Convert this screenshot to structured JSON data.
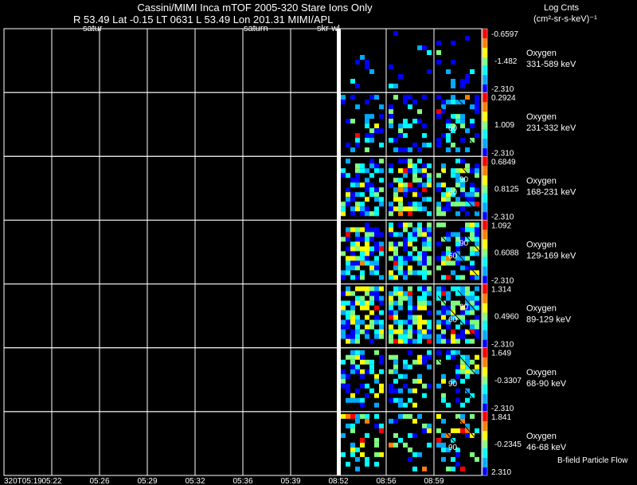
{
  "header": {
    "title": "Cassini/MIMI Inca mTOF  2005-320   Stare    Ions Only",
    "ephemeris": "R         53.49 Lat -0.15 LT 0631 L          53.49 Lon       201.31   MIMI/APL",
    "units_line1": "Log Cnts",
    "units_line2": "(cm²-sr-s-keV)⁻¹"
  },
  "annotations": [
    "satur",
    "saturn",
    "skr-wl"
  ],
  "footer": {
    "text": "B-field Particle Flow"
  },
  "chart_data": {
    "type": "heatmap",
    "time_labels": [
      "320T05:19",
      "05:22",
      "05:26",
      "05:29",
      "05:32",
      "05:36",
      "05:39",
      "08:52",
      "08:56",
      "08:59"
    ],
    "colorscale": [
      "#0000ff",
      "#00aaff",
      "#00ffff",
      "#80ff80",
      "#ffff00",
      "#ff8000",
      "#ff0000"
    ],
    "panels": [
      {
        "species": "Oxygen",
        "energy": "331-589 keV",
        "cmax": "-0.6597",
        "cmid": "-1.482",
        "cmin": "-2.310",
        "density": 0.1,
        "bias": 0.1,
        "contours": []
      },
      {
        "species": "Oxygen",
        "energy": "231-332 keV",
        "cmax": "0.2924",
        "cmid": "1.009",
        "cmin": "-2.310",
        "density": 0.35,
        "bias": 0.2,
        "contours": [
          "60"
        ]
      },
      {
        "species": "Oxygen",
        "energy": "168-231 keV",
        "cmax": "0.6849",
        "cmid": "0.8125",
        "cmin": "-2.310",
        "density": 0.55,
        "bias": 0.3,
        "contours": [
          "60",
          "90"
        ]
      },
      {
        "species": "Oxygen",
        "energy": "129-169 keV",
        "cmax": "1.092",
        "cmid": "0.6088",
        "cmin": "-2.310",
        "density": 0.62,
        "bias": 0.3,
        "contours": [
          "60",
          "90"
        ]
      },
      {
        "species": "Oxygen",
        "energy": "89-129 keV",
        "cmax": "1.314",
        "cmid": "0.4960",
        "cmin": "-2.310",
        "density": 0.7,
        "bias": 0.32,
        "contours": [
          "60",
          "90"
        ]
      },
      {
        "species": "Oxygen",
        "energy": "68-90 keV",
        "cmax": "1.649",
        "cmid": "-0.3307",
        "cmin": "-2.310",
        "density": 0.4,
        "bias": 0.3,
        "contours": [
          "90"
        ]
      },
      {
        "species": "Oxygen",
        "energy": "46-68 keV",
        "cmax": "1.841",
        "cmid": "-0.2345",
        "cmin": "2.310",
        "density": 0.25,
        "bias": 0.4,
        "contours": [
          "90"
        ]
      }
    ]
  }
}
